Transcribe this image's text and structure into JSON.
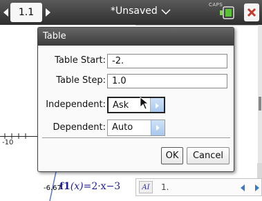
{
  "topbar": {
    "page_tab": "1.1",
    "document_title": "*Unsaved",
    "caps_indicator": "CAPS"
  },
  "graph": {
    "axis_label_left": "-10",
    "function_value": "-6.67",
    "function_name": "f1",
    "function_arg": "(x)",
    "function_definition": "=2·x−3"
  },
  "entry_line": {
    "badge": "AI",
    "value": "1."
  },
  "dialog": {
    "title": "Table",
    "fields": {
      "table_start_label": "Table Start:",
      "table_start_value": "-2.",
      "table_step_label": "Table Step:",
      "table_step_value": "1.0",
      "independent_label": "Independent:",
      "independent_value": "Ask",
      "dependent_label": "Dependent:",
      "dependent_value": "Auto"
    },
    "buttons": {
      "ok": "OK",
      "cancel": "Cancel"
    }
  },
  "colors": {
    "titlebar": "#3c3c3c",
    "select_arrow_accent": "#a9c8ec",
    "function_text": "#1a1a9a",
    "curve": "#5a78c8"
  }
}
